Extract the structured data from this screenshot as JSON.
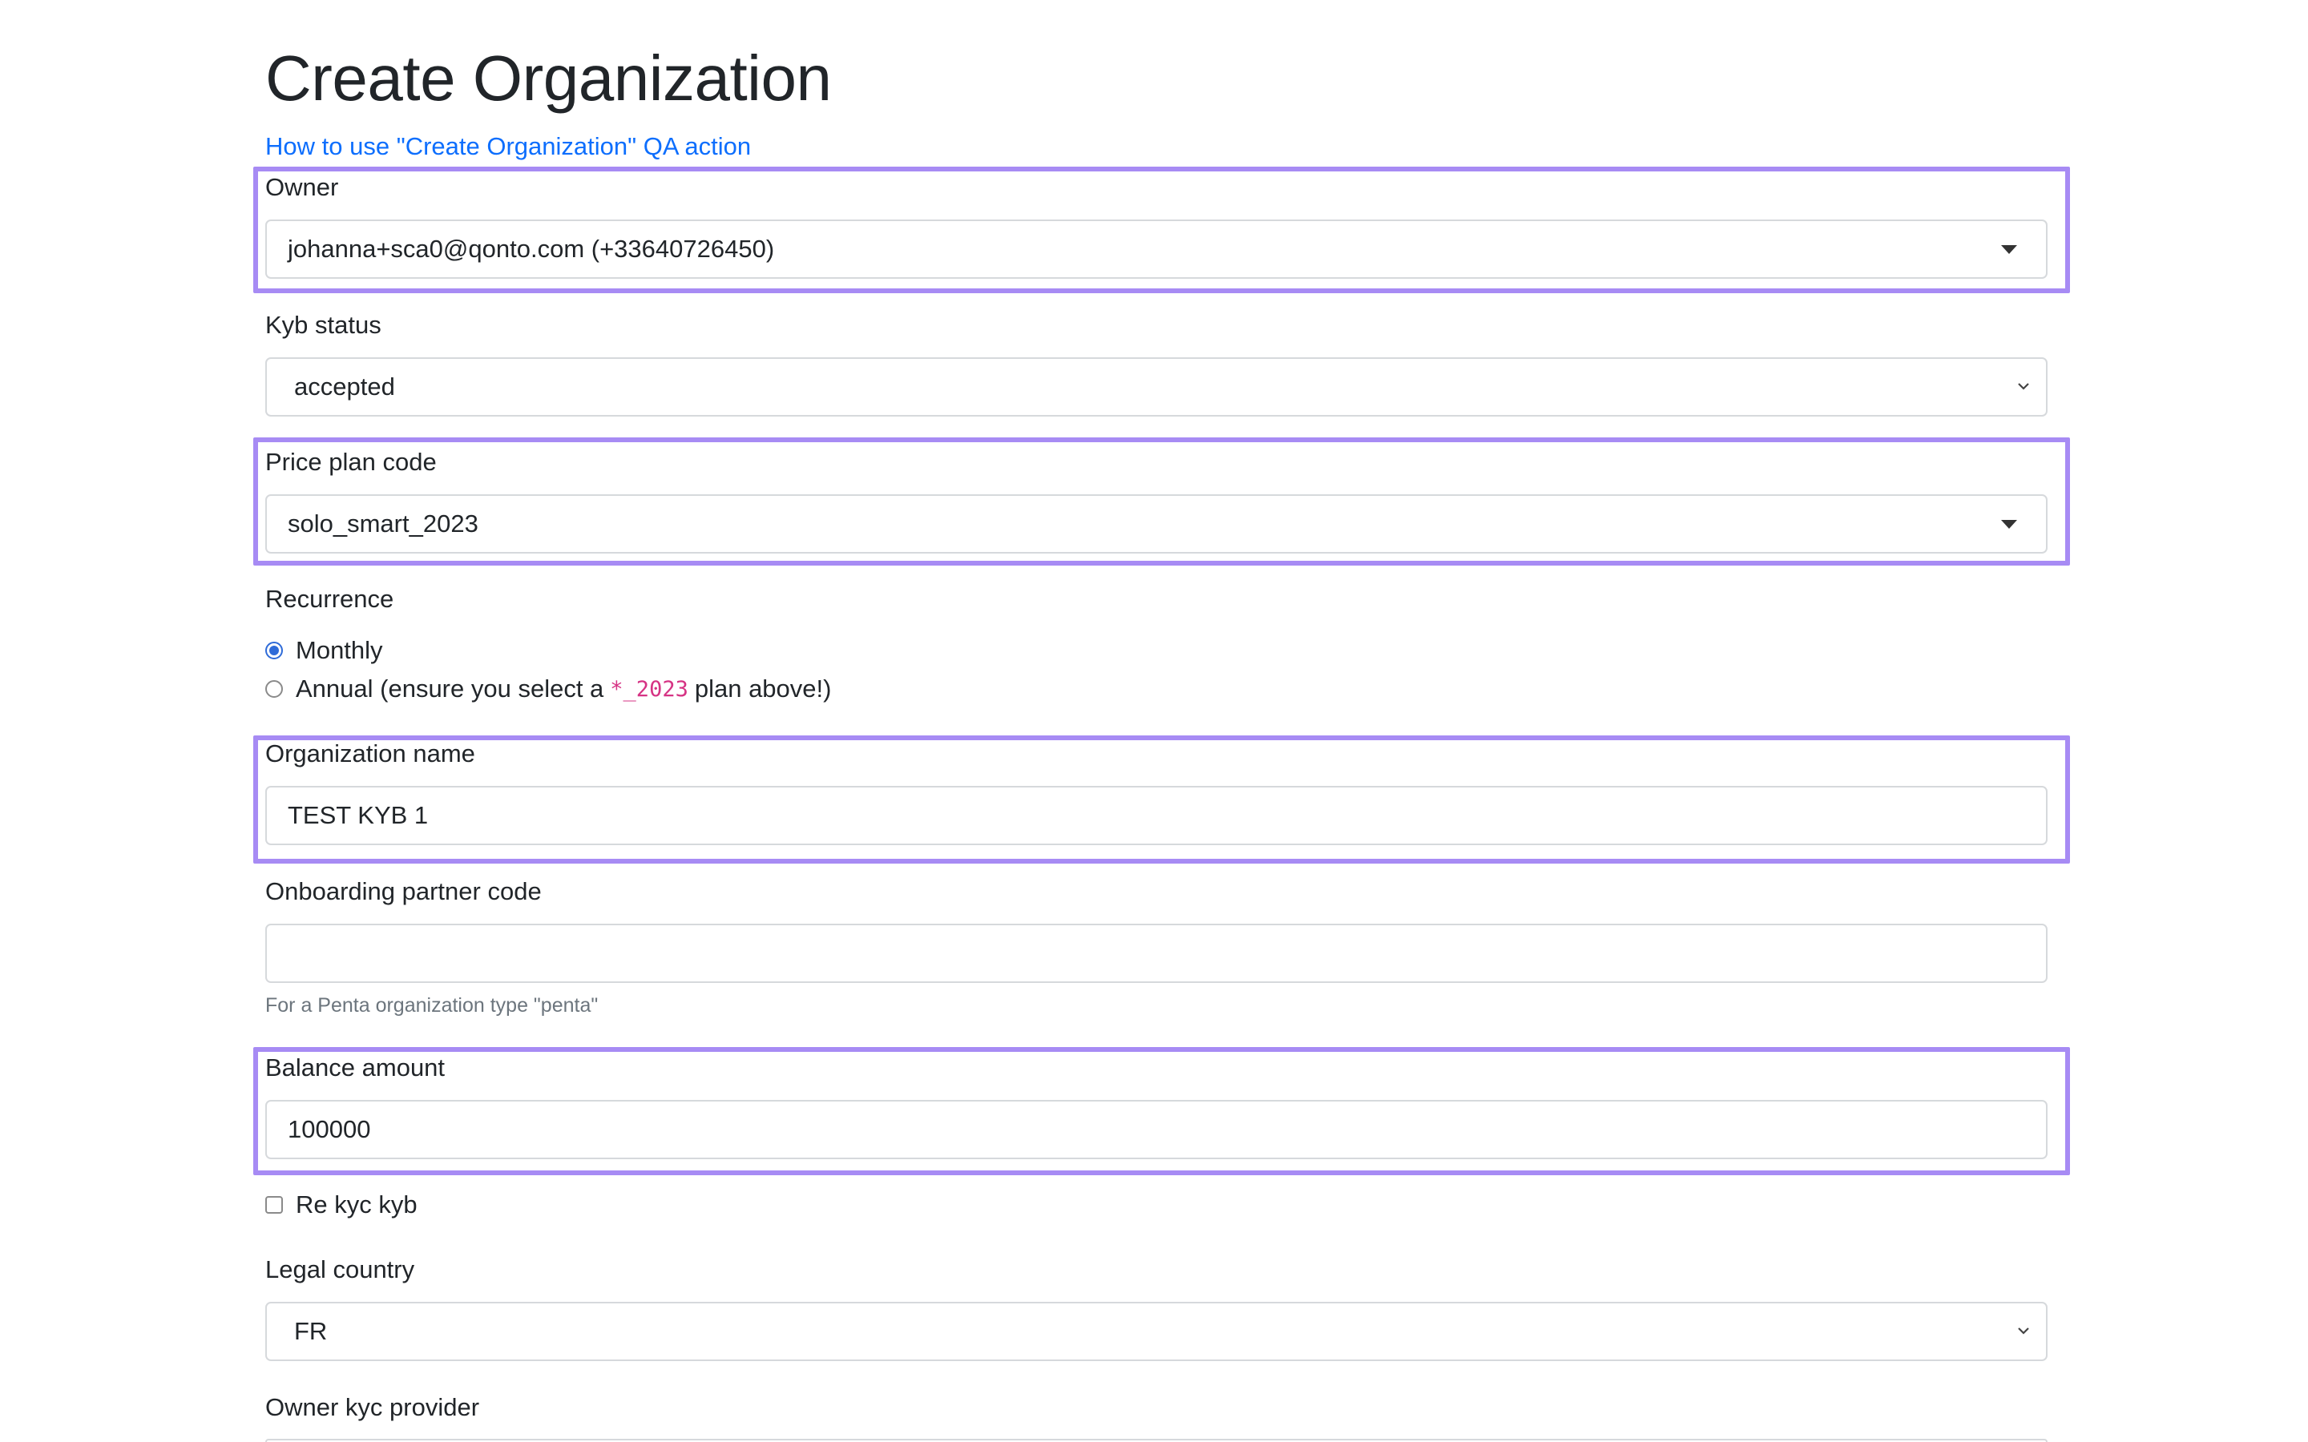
{
  "page": {
    "title": "Create Organization",
    "help_link": "How to use \"Create Organization\" QA action"
  },
  "form": {
    "owner": {
      "label": "Owner",
      "value": "johanna+sca0@qonto.com (+33640726450)"
    },
    "kyb_status": {
      "label": "Kyb status",
      "value": "accepted"
    },
    "price_plan_code": {
      "label": "Price plan code",
      "value": "solo_smart_2023"
    },
    "recurrence": {
      "label": "Recurrence",
      "options": [
        {
          "label": "Monthly",
          "checked": true
        },
        {
          "label_before": "Annual (ensure you select a",
          "code": "*_2023",
          "label_after": "plan above!)",
          "checked": false
        }
      ]
    },
    "organization_name": {
      "label": "Organization name",
      "value": "TEST KYB 1"
    },
    "onboarding_partner_code": {
      "label": "Onboarding partner code",
      "value": "",
      "help": "For a Penta organization type \"penta\""
    },
    "balance_amount": {
      "label": "Balance amount",
      "value": "100000"
    },
    "re_kyc_kyb": {
      "label": "Re kyc kyb",
      "checked": false
    },
    "legal_country": {
      "label": "Legal country",
      "value": "FR"
    },
    "owner_kyc_provider": {
      "label": "Owner kyc provider"
    }
  },
  "colors": {
    "highlight": "#a78bf4",
    "link": "#0d6efd",
    "code": "#d63384",
    "radio_checked": "#2f6bd8"
  }
}
